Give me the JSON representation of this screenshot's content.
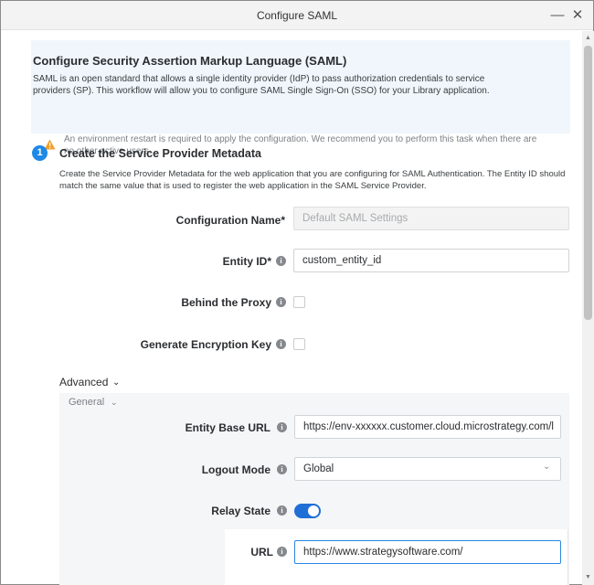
{
  "window": {
    "title": "Configure SAML",
    "minimize_glyph": "—",
    "close_glyph": "✕"
  },
  "banner": {
    "title": "Configure Security Assertion Markup Language (SAML)",
    "description": "SAML is an open standard that allows a single identity provider (IdP) to pass authorization credentials to service providers (SP). This workflow will allow you to configure SAML Single Sign-On (SSO) for your Library application.",
    "warning_icon": "warning-triangle-icon",
    "warning": "An environment restart is required to apply the configuration. We recommend you to perform this task when there are no other active users."
  },
  "step": {
    "number": "1",
    "title": "Create the Service Provider Metadata",
    "description": "Create the Service Provider Metadata for the web application that you are configuring for SAML Authentication. The Entity ID should match the same value that is used to register the web application in the SAML Service Provider."
  },
  "fields": {
    "config_name": {
      "label": "Configuration Name*",
      "placeholder": "Default SAML Settings"
    },
    "entity_id": {
      "label": "Entity ID*",
      "value": "custom_entity_id"
    },
    "behind_proxy": {
      "label": "Behind the Proxy",
      "checked": false
    },
    "gen_key": {
      "label": "Generate Encryption Key",
      "checked": false
    }
  },
  "advanced": {
    "label": "Advanced",
    "general_label": "General",
    "entity_base_url": {
      "label": "Entity Base URL",
      "value": "https://env-xxxxxx.customer.cloud.microstrategy.com/l"
    },
    "logout_mode": {
      "label": "Logout Mode",
      "value": "Global"
    },
    "relay_state": {
      "label": "Relay State",
      "enabled": true
    },
    "url": {
      "label": "URL",
      "value": "https://www.strategysoftware.com/"
    }
  },
  "info_glyph": "i",
  "chevron_glyph": "⌄",
  "colors": {
    "accent": "#1f89e5",
    "toggle_on": "#1f6fd6",
    "banner_bg": "#f0f6fb",
    "warning": "#f0a030"
  }
}
